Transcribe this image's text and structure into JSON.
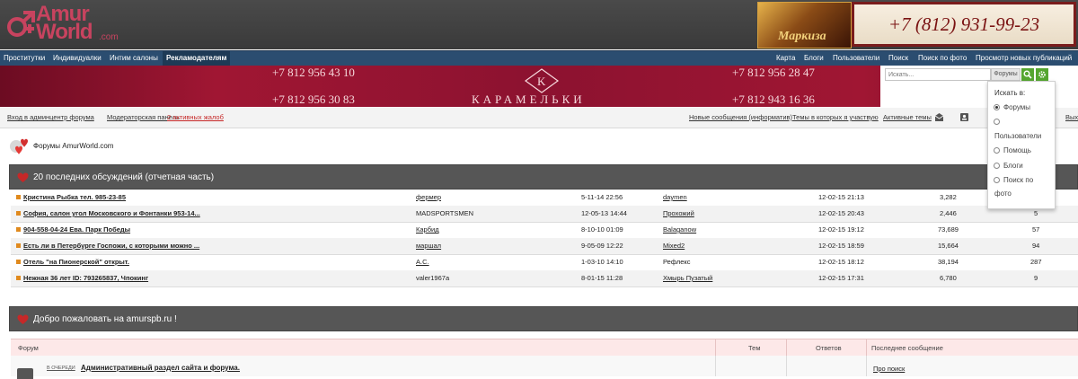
{
  "header": {
    "logo_top": "Amur",
    "logo_bottom": "World",
    "logo_domain": ".com",
    "ad_name": "Маркиза",
    "ad_phone": "+7 (812) 931-99-23"
  },
  "nav": {
    "left": [
      "Проститутки",
      "Индивидуалки",
      "Интим салоны",
      "Рекламодателям"
    ],
    "right": [
      "Карта",
      "Блоги",
      "Пользователи",
      "Поиск",
      "Поиск по фото",
      "Просмотр новых публикаций"
    ]
  },
  "banner": {
    "phones": [
      "+7 812 956 43 10",
      "+7 812 956 30 83",
      "+7 812 956 28 47",
      "+7 812 943 16 36"
    ],
    "brand": "КАРАМЕЛЬКИ"
  },
  "search": {
    "placeholder": "Искать...",
    "scope": "Форумы",
    "dropdown_title": "Искать в:",
    "options": [
      "Форумы",
      "Пользователи",
      "Помощь",
      "Блоги",
      "Поиск по"
    ],
    "options_extra": "фото"
  },
  "toolbar": {
    "admin_link": "Вход в админцентр форума",
    "mod_link": "Модераторская панель",
    "reports": "2 активных жалоб",
    "new_posts": "Новые сообщения (информатив)",
    "my_topics": "Темы в которых я участвую",
    "active_topics": "Активные темы",
    "exit": "Вых"
  },
  "breadcrumb": "Форумы AmurWorld.com",
  "discussions": {
    "title": "20 последних обсуждений (отчетная часть)",
    "rows": [
      {
        "title": "Кристина Рыбка тел. 985-23-85",
        "author": "фермер",
        "started": "5-11-14 22:56",
        "last_user": "daymen",
        "last_date": "12-02-15 21:13",
        "views": "3,282",
        "replies": ""
      },
      {
        "title": "София, салон угол Московского и Фонтанки 953-14...",
        "author": "MADSPORTSMEN",
        "started": "12-05-13 14:44",
        "last_user": "Прохожий",
        "last_date": "12-02-15 20:43",
        "views": "2,446",
        "replies": "5"
      },
      {
        "title": "904-558-04-24 Ева. Парк Победы",
        "author": "Карбид",
        "started": "8-10-10 01:09",
        "last_user": "Balaganow",
        "last_date": "12-02-15 19:12",
        "views": "73,689",
        "replies": "57"
      },
      {
        "title": "Есть ли в Петербурге Госпожи, с которыми можно ...",
        "author": "маршал",
        "started": "9-05-09 12:22",
        "last_user": "Mixed2",
        "last_date": "12-02-15 18:59",
        "views": "15,664",
        "replies": "94"
      },
      {
        "title": "Отель \"на Пионерской\" открыт.",
        "author": "A.C.",
        "started": "1-03-10 14:10",
        "last_user": "Рефлекс",
        "last_date": "12-02-15 18:12",
        "views": "38,194",
        "replies": "287"
      },
      {
        "title": "Нежная 36 лет ID: 793265837, Чпокинг",
        "author": "valer1967a",
        "started": "8-01-15 11:28",
        "last_user": "Хмырь Пузатый",
        "last_date": "12-02-15 17:31",
        "views": "6,780",
        "replies": "9"
      }
    ]
  },
  "welcome": {
    "title": "Добро пожаловать на amurspb.ru !",
    "headers": [
      "Форум",
      "Тем",
      "Ответов",
      "Последнее сообщение"
    ],
    "row": {
      "tag": "В ОЧЕРЕДИ",
      "title": "Административный раздел сайта и форума.",
      "last_post": "Про поиск"
    }
  },
  "colors": {
    "header_bg": "#3f3f3f",
    "nav_bg": "#2b4d70",
    "banner_bg": "#a01633",
    "section_head": "#565656",
    "accent_green": "#55a630",
    "logo_pink": "#c8435f"
  }
}
